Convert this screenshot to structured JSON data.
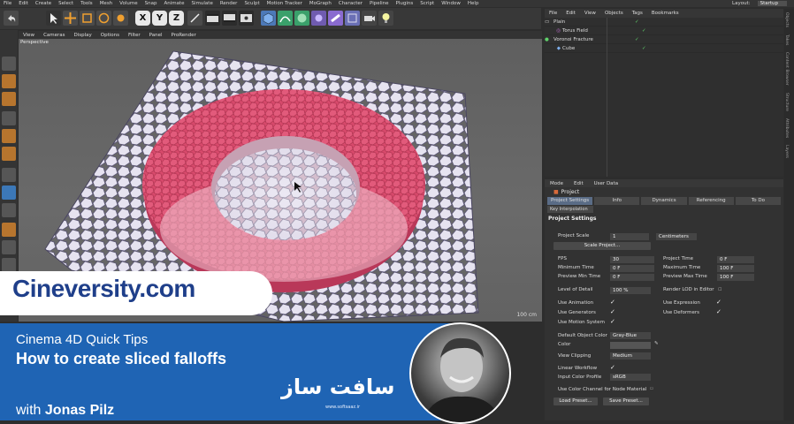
{
  "menubar": {
    "items": [
      "File",
      "Edit",
      "Create",
      "Select",
      "Tools",
      "Mesh",
      "Volume",
      "Snap",
      "Animate",
      "Simulate",
      "Render",
      "Sculpt",
      "Motion Tracker",
      "MoGraph",
      "Character",
      "Pipeline",
      "Plugins",
      "Script",
      "Window",
      "Help"
    ],
    "layout_label": "Layout:",
    "layout_value": "Startup"
  },
  "toolbar": {
    "axis_x": "X",
    "axis_y": "Y",
    "axis_z": "Z",
    "icons": [
      "undo-icon",
      "select-icon",
      "move-icon",
      "scale-icon",
      "rotate-icon",
      "cube-icon",
      "render-icon",
      "spline-icon",
      "generator-icon",
      "deformer-icon",
      "camera-icon",
      "light-icon"
    ]
  },
  "viewport": {
    "menu": [
      "View",
      "Cameras",
      "Display",
      "Options",
      "Filter",
      "Panel",
      "ProRender"
    ],
    "label": "Perspective",
    "grid_spacing": "100 cm"
  },
  "object_manager": {
    "menu": [
      "File",
      "Edit",
      "View",
      "Objects",
      "Tags",
      "Bookmarks"
    ],
    "objects": [
      {
        "name": "Plain",
        "indent": 0
      },
      {
        "name": "Torus Field",
        "indent": 1
      },
      {
        "name": "Voronoi Fracture",
        "indent": 0
      },
      {
        "name": "Cube",
        "indent": 1
      }
    ]
  },
  "attributes": {
    "menu": [
      "Mode",
      "Edit",
      "User Data"
    ],
    "title": "Project",
    "tabs": [
      "Project Settings",
      "Info",
      "Dynamics",
      "Referencing",
      "To Do"
    ],
    "tab_row2": "Key Interpolation",
    "section": "Project Settings",
    "project_scale_label": "Project Scale",
    "project_scale_value": "1",
    "project_scale_unit": "Centimeters",
    "scale_project_btn": "Scale Project...",
    "fps_label": "FPS",
    "fps_value": "30",
    "project_time_label": "Project Time",
    "project_time_value": "0 F",
    "min_time_label": "Minimum Time",
    "min_time_value": "0 F",
    "max_time_label": "Maximum Time",
    "max_time_value": "100 F",
    "preview_min_label": "Preview Min Time",
    "preview_min_value": "0 F",
    "preview_max_label": "Preview Max Time",
    "preview_max_value": "100 F",
    "lod_label": "Level of Detail",
    "lod_value": "100 %",
    "render_lod_label": "Render LOD in Editor",
    "use_animation": "Use Animation",
    "use_expression": "Use Expression",
    "use_generators": "Use Generators",
    "use_deformers": "Use Deformers",
    "use_motion_system": "Use Motion System",
    "default_color_label": "Default Object Color",
    "default_color_value": "Gray-Blue",
    "color_label": "Color",
    "view_clipping_label": "View Clipping",
    "view_clipping_value": "Medium",
    "linear_workflow_label": "Linear Workflow",
    "input_color_label": "Input Color Profile",
    "input_color_value": "sRGB",
    "use_color_channel_label": "Use Color Channel for Node Material",
    "load_preset_btn": "Load Preset...",
    "save_preset_btn": "Save Preset..."
  },
  "side_tabs": [
    "Objects",
    "Takes",
    "Content Browser",
    "Structure",
    "Attributes",
    "Layers"
  ],
  "overlay": {
    "brand": "Cineversity.com",
    "subtitle": "Cinema 4D Quick Tips",
    "title": "How to create sliced falloffs",
    "author_prefix": "with ",
    "author_name": "Jonas Pilz",
    "watermark": "سافت ساز",
    "watermark_url": "www.softsaaz.ir"
  },
  "colors": {
    "accent_blue": "#1f64b4",
    "brand_text": "#1f3f8a",
    "mesh_pink": "#d8486a",
    "tab_active": "#5a6c86"
  }
}
